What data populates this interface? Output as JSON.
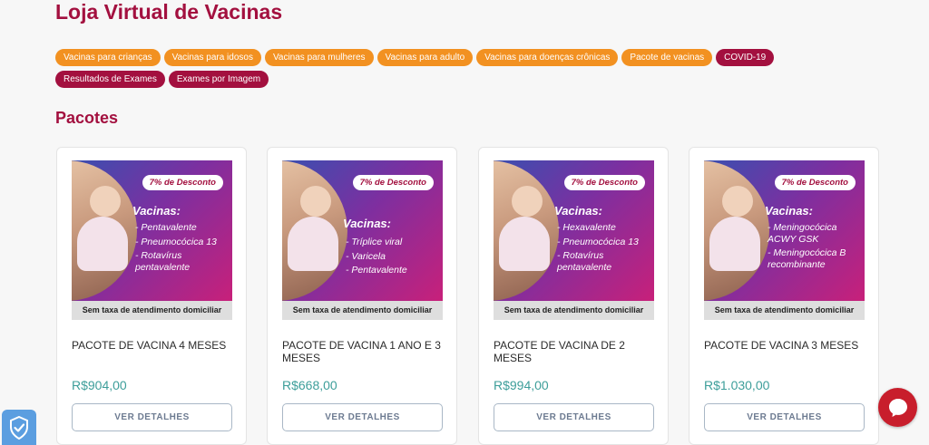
{
  "page": {
    "title": "Loja Virtual de Vacinas",
    "section_title": "Pacotes"
  },
  "categories": [
    {
      "label": "Vacinas para crianças",
      "color": "#f29121"
    },
    {
      "label": "Vacinas para idosos",
      "color": "#f29121"
    },
    {
      "label": "Vacinas para mulheres",
      "color": "#f29121"
    },
    {
      "label": "Vacinas para adulto",
      "color": "#f29121"
    },
    {
      "label": "Vacinas para doenças crônicas",
      "color": "#f29121"
    },
    {
      "label": "Pacote de vacinas",
      "color": "#f29121"
    },
    {
      "label": "COVID-19",
      "color": "#a3103f"
    },
    {
      "label": "Resultados de Exames",
      "color": "#a3103f"
    },
    {
      "label": "Exames por Imagem",
      "color": "#a3103f"
    }
  ],
  "products": [
    {
      "discount": "7% de Desconto",
      "vaccines_title": "Vacinas:",
      "vaccines": [
        "- Pentavalente",
        "- Pneumocócica 13",
        "- Rotavírus pentavalente"
      ],
      "tax_note": "Sem taxa de atendimento domiciliar",
      "name": "PACOTE DE VACINA 4 MESES",
      "price": "R$904,00",
      "button": "VER DETALHES"
    },
    {
      "discount": "7% de Desconto",
      "vaccines_title": "Vacinas:",
      "vaccines": [
        "- Tríplice viral",
        "- Varicela",
        "- Pentavalente"
      ],
      "tax_note": "Sem taxa de atendimento domiciliar",
      "name": "PACOTE DE VACINA 1 ANO E 3 MESES",
      "price": "R$668,00",
      "button": "VER DETALHES"
    },
    {
      "discount": "7% de Desconto",
      "vaccines_title": "Vacinas:",
      "vaccines": [
        "- Hexavalente",
        "- Pneumocócica 13",
        "- Rotavírus pentavalente"
      ],
      "tax_note": "Sem taxa de atendimento domiciliar",
      "name": "PACOTE DE VACINA DE 2 MESES",
      "price": "R$994,00",
      "button": "VER DETALHES"
    },
    {
      "discount": "7% de Desconto",
      "vaccines_title": "Vacinas:",
      "vaccines": [
        "- Meningocócica ACWY GSK",
        "- Meningocócica B recombinante"
      ],
      "tax_note": "Sem taxa de atendimento domiciliar",
      "name": "PACOTE DE VACINA 3 MESES",
      "price": "R$1.030,00",
      "button": "VER DETALHES"
    }
  ],
  "widgets": {
    "privacy_icon": "shield-check-icon",
    "chat_icon": "chat-bubble-icon"
  },
  "colors": {
    "brand": "#a3103f",
    "accent_orange": "#f29121",
    "price": "#3d9e9a"
  }
}
